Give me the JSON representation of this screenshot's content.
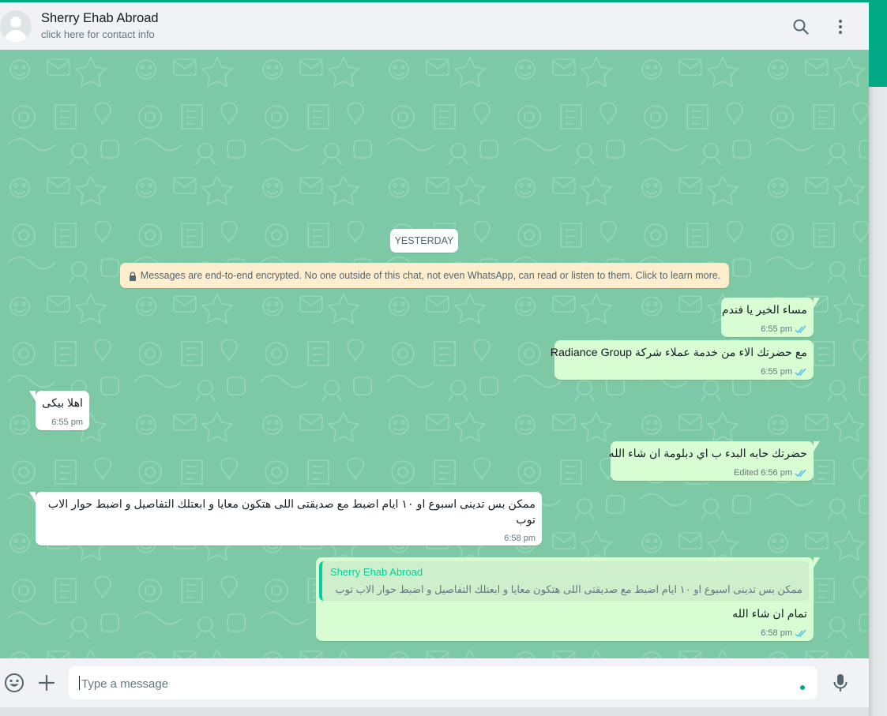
{
  "header": {
    "contact_name": "Sherry Ehab Abroad",
    "contact_subtitle": "click here for contact info",
    "search_icon": "search-icon",
    "menu_icon": "kebab-menu-icon"
  },
  "chat": {
    "date_divider": "YESTERDAY",
    "encryption_notice": "Messages are end-to-end encrypted. No one outside of this chat, not even WhatsApp, can read or listen to them. Click to learn more.",
    "messages": [
      {
        "direction": "out",
        "text": "مساء الخير يا فندم",
        "time": "6:55 pm",
        "status": "read"
      },
      {
        "direction": "out",
        "text": "مع حضرتك الاء من خدمة عملاء شركة Radiance Group",
        "time": "6:55 pm",
        "status": "read"
      },
      {
        "direction": "in",
        "text": "اهلا بيكى",
        "time": "6:55 pm"
      },
      {
        "direction": "out",
        "text": "حضرتك حابه البدء ب اي دبلومة ان شاء الله",
        "edited": "Edited",
        "time": "6:56 pm",
        "status": "read"
      },
      {
        "direction": "in",
        "text_line1": "ممكن بس تدينى اسبوع او ١٠ ايام اضبط مع صديقتى اللى هتكون معايا و ابعتلك التفاصيل و اضبط حوار الاب",
        "text_line2": "توب",
        "time": "6:58 pm"
      },
      {
        "direction": "out",
        "quoted_name": "Sherry Ehab Abroad",
        "quoted_text": "ممكن بس تدينى اسبوع او ١٠ ايام اضبط مع صديقتى اللى هتكون معايا و ابعتلك التفاصيل و اضبط حوار الاب توب",
        "text": "تمام ان شاء الله",
        "time": "6:58 pm",
        "status": "read"
      }
    ]
  },
  "composer": {
    "placeholder": "Type a message",
    "emoji_icon": "emoji-icon",
    "attach_icon": "plus-icon",
    "mic_icon": "microphone-icon"
  },
  "colors": {
    "accent": "#00a884",
    "chat_background": "#7dc9a6",
    "outgoing_bubble": "#d9fdd3",
    "incoming_bubble": "#ffffff",
    "read_tick": "#53bdeb"
  }
}
